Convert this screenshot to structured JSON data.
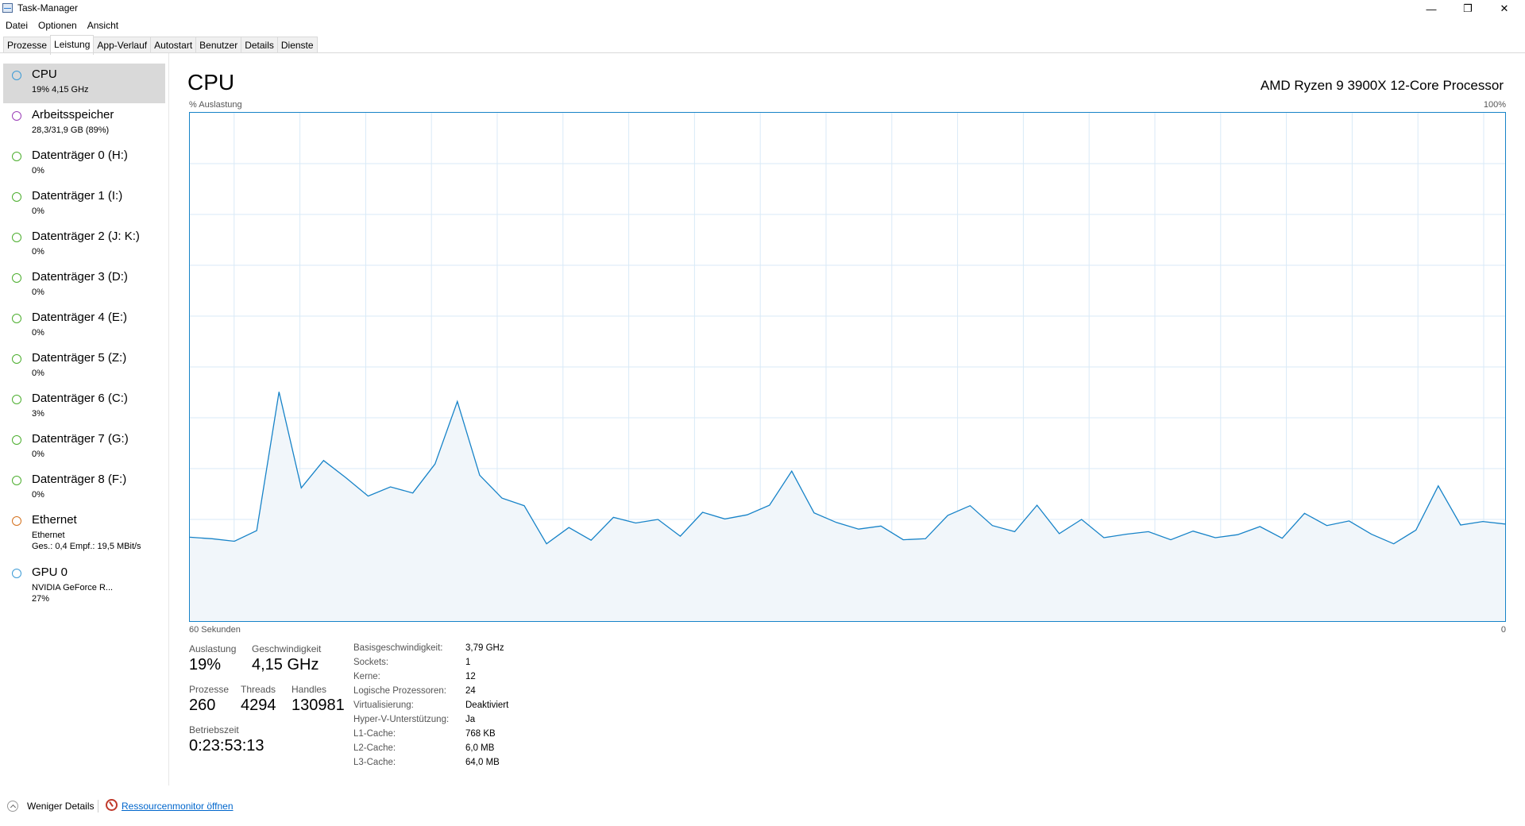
{
  "window": {
    "title": "Task-Manager",
    "minimize_glyph": "—",
    "restore_glyph": "❐",
    "close_glyph": "✕"
  },
  "menu": [
    "Datei",
    "Optionen",
    "Ansicht"
  ],
  "tabs": [
    "Prozesse",
    "Leistung",
    "App-Verlauf",
    "Autostart",
    "Benutzer",
    "Details",
    "Dienste"
  ],
  "active_tab": "Leistung",
  "sidebar": [
    {
      "title": "CPU",
      "sub": [
        "19% 4,15 GHz"
      ],
      "color": "#3c9bd6",
      "selected": true
    },
    {
      "title": "Arbeitsspeicher",
      "sub": [
        "28,3/31,9 GB (89%)"
      ],
      "color": "#9b3fb8"
    },
    {
      "title": "Datenträger 0 (H:)",
      "sub": [
        "0%"
      ],
      "color": "#4cae2e"
    },
    {
      "title": "Datenträger 1 (I:)",
      "sub": [
        "0%"
      ],
      "color": "#4cae2e"
    },
    {
      "title": "Datenträger 2 (J: K:)",
      "sub": [
        "0%"
      ],
      "color": "#4cae2e"
    },
    {
      "title": "Datenträger 3 (D:)",
      "sub": [
        "0%"
      ],
      "color": "#4cae2e"
    },
    {
      "title": "Datenträger 4 (E:)",
      "sub": [
        "0%"
      ],
      "color": "#4cae2e"
    },
    {
      "title": "Datenträger 5 (Z:)",
      "sub": [
        "0%"
      ],
      "color": "#4cae2e"
    },
    {
      "title": "Datenträger 6 (C:)",
      "sub": [
        "3%"
      ],
      "color": "#4cae2e"
    },
    {
      "title": "Datenträger 7 (G:)",
      "sub": [
        "0%"
      ],
      "color": "#4cae2e"
    },
    {
      "title": "Datenträger 8 (F:)",
      "sub": [
        "0%"
      ],
      "color": "#4cae2e"
    },
    {
      "title": "Ethernet",
      "sub": [
        "Ethernet",
        "Ges.: 0,4 Empf.: 19,5 MBit/s"
      ],
      "color": "#d4711d"
    },
    {
      "title": "GPU 0",
      "sub": [
        "NVIDIA GeForce R...",
        "27%"
      ],
      "color": "#3c9bd6"
    }
  ],
  "main": {
    "title": "CPU",
    "processor": "AMD Ryzen 9 3900X 12-Core Processor",
    "graph_label": "% Auslastung",
    "graph_max": "100%",
    "graph_time": "60 Sekunden",
    "graph_zero": "0"
  },
  "chart_data": {
    "type": "area",
    "x_range_seconds": [
      60,
      0
    ],
    "ylim": [
      0,
      100
    ],
    "grid": true,
    "values": [
      16.5,
      16.2,
      15.7,
      17.8,
      45.1,
      26.2,
      31.6,
      28.2,
      24.6,
      26.4,
      25.2,
      30.9,
      43.2,
      28.7,
      24.2,
      22.7,
      15.2,
      18.4,
      15.9,
      20.4,
      19.3,
      20.0,
      16.7,
      21.4,
      20.1,
      20.9,
      22.8,
      29.5,
      21.3,
      19.4,
      18.1,
      18.7,
      16.0,
      16.2,
      20.8,
      22.7,
      18.8,
      17.6,
      22.8,
      17.2,
      20.0,
      16.4,
      17.1,
      17.6,
      16.0,
      17.7,
      16.4,
      17.0,
      18.6,
      16.3,
      21.2,
      18.8,
      19.7,
      17.1,
      15.2,
      17.9,
      26.6,
      18.9,
      19.6,
      19.1
    ],
    "line_color": "#1783c8",
    "fill_color": "#f1f6fa",
    "grid_color": "#d9eaf7"
  },
  "stats": {
    "auslastung_label": "Auslastung",
    "auslastung": "19%",
    "geschwindigkeit_label": "Geschwindigkeit",
    "geschwindigkeit": "4,15 GHz",
    "prozesse_label": "Prozesse",
    "prozesse": "260",
    "threads_label": "Threads",
    "threads": "4294",
    "handles_label": "Handles",
    "handles": "130981",
    "betriebszeit_label": "Betriebszeit",
    "betriebszeit": "0:23:53:13"
  },
  "specs": [
    {
      "k": "Basisgeschwindigkeit:",
      "v": "3,79 GHz"
    },
    {
      "k": "Sockets:",
      "v": "1"
    },
    {
      "k": "Kerne:",
      "v": "12"
    },
    {
      "k": "Logische Prozessoren:",
      "v": "24"
    },
    {
      "k": "Virtualisierung:",
      "v": "Deaktiviert"
    },
    {
      "k": "Hyper-V-Unterstützung:",
      "v": "Ja"
    },
    {
      "k": "L1-Cache:",
      "v": "768 KB"
    },
    {
      "k": "L2-Cache:",
      "v": "6,0 MB"
    },
    {
      "k": "L3-Cache:",
      "v": "64,0 MB"
    }
  ],
  "footer": {
    "fewer_details": "Weniger Details",
    "resource_monitor": "Ressourcenmonitor öffnen"
  }
}
